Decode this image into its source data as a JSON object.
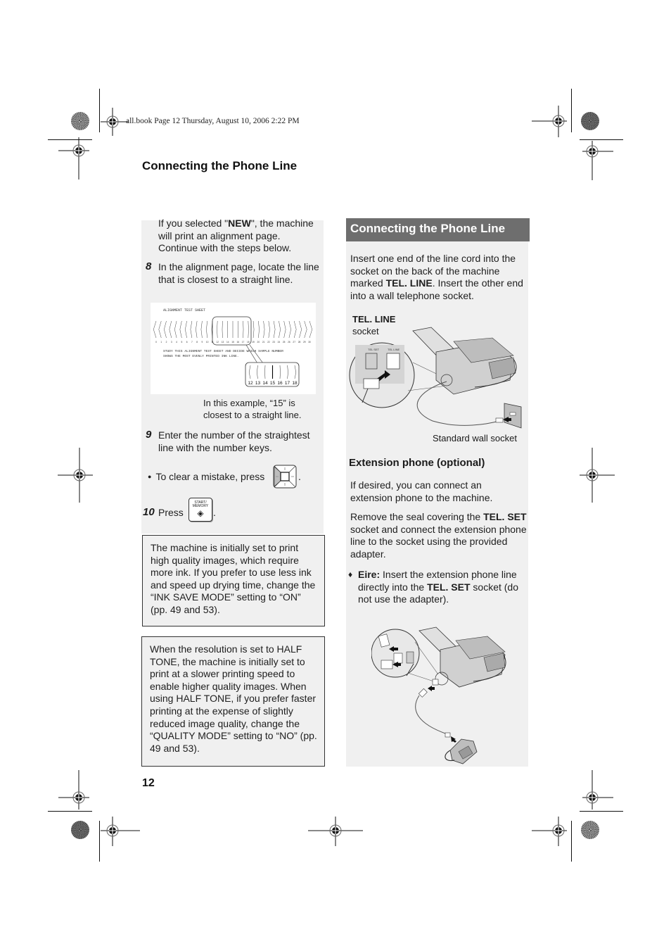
{
  "print_header": "all.book  Page 12  Thursday, August 10, 2006  2:22 PM",
  "section_title": "Connecting the Phone Line",
  "page_number": "12",
  "left": {
    "intro": {
      "pre": "If you selected \"",
      "bold": "NEW",
      "post": "\", the machine will print an alignment page. Continue with the steps below."
    },
    "step8": {
      "num": "8",
      "text": "In the alignment page, locate the line that is closest to a straight line."
    },
    "alignment_sheet": {
      "title": "ALIGNMENT TEST SHEET",
      "numbers": [
        "0",
        "1",
        "2",
        "3",
        "4",
        "5",
        "6",
        "7",
        "8",
        "9",
        "10",
        "11",
        "12",
        "13",
        "14",
        "15",
        "16",
        "17",
        "18",
        "19",
        "20",
        "21",
        "22",
        "23",
        "24",
        "25",
        "26",
        "27",
        "28",
        "29",
        "30"
      ],
      "instruction_line1": "STUDY THIS ALIGNMENT TEST SHEET AND DECIDE WHICH SAMPLE NUMBER",
      "instruction_line2": "SHOWS THE MOST EVENLY PRINTED INK LINE.",
      "zoom_numbers": [
        "12",
        "13",
        "14",
        "15",
        "16",
        "17",
        "18"
      ],
      "selected": "15"
    },
    "example_caption": "In this example, “15” is closest to a straight line.",
    "step9": {
      "num": "9",
      "text": "Enter the number of the straightest line with the number keys."
    },
    "bullet_clear": {
      "text": "To clear a mistake, press",
      "key_icon": "left-arrow-key-icon",
      "suffix": "."
    },
    "step10": {
      "num": "10",
      "text": "Press",
      "key_label_1": "START/",
      "key_label_2": "MEMORY",
      "key_glyph": "◈",
      "suffix": "."
    },
    "note1": "The machine is initially set to print high quality images, which require more ink. If you prefer to use less ink and speed up drying time, change the “INK SAVE MODE” setting to “ON” (pp. 49 and 53).",
    "note2": "When the resolution is set to HALF TONE, the machine is initially set to print at a slower printing speed to enable higher quality images. When using HALF TONE, if you prefer faster printing at the expense of slightly reduced image quality, change the “QUALITY MODE” setting to “NO” (pp. 49 and 53)."
  },
  "right": {
    "title": "Connecting the Phone Line",
    "intro": {
      "pre": "Insert one end of the line cord into the socket on the back of the machine marked ",
      "bold": "TEL. LINE",
      "post": ". Insert the other end into a wall telephone socket."
    },
    "fig1": {
      "label_bold": "TEL. LINE",
      "label_sub": "socket",
      "socket_set": "TEL SET",
      "socket_line": "TEL LINE",
      "wall_caption": "Standard wall socket"
    },
    "ext_heading": "Extension phone (optional)",
    "ext_p1": "If desired, you can connect an extension phone to the machine.",
    "ext_p2": {
      "pre": "Remove the seal covering the ",
      "bold": "TEL. SET",
      "post": " socket and connect the extension phone line to the socket using the provided adapter."
    },
    "eire": {
      "bullet": "♦",
      "label": "Eire:",
      "pre": " Insert the extension phone line directly into the ",
      "bold": "TEL. SET",
      "post": " socket (do not use the adapter)."
    }
  }
}
